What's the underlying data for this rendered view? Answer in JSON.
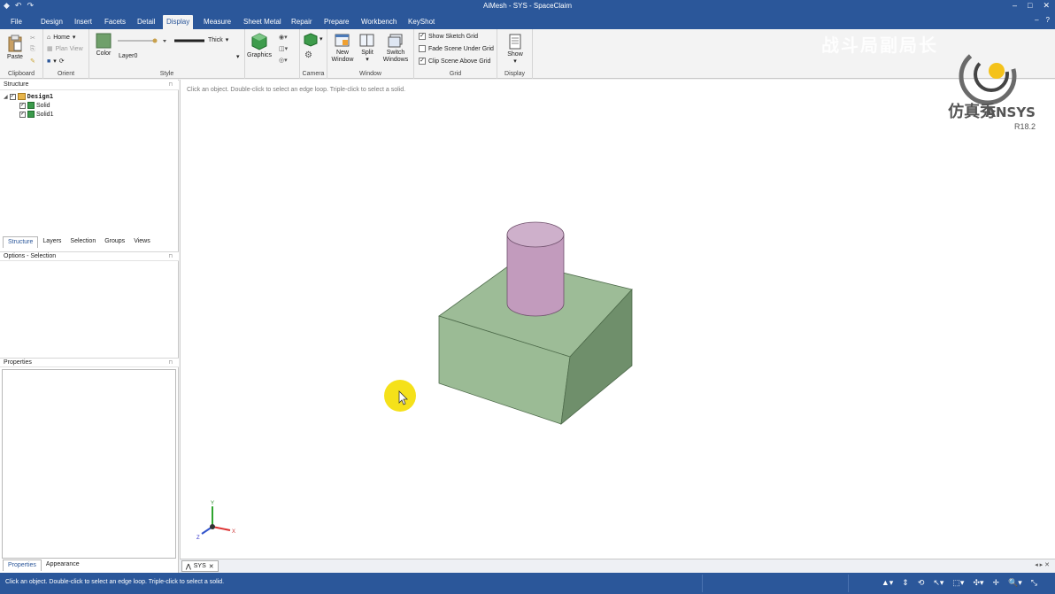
{
  "window": {
    "title": "AiMesh - SYS - SpaceClaim",
    "qat": [
      "↶",
      "↷"
    ],
    "controls": [
      "–",
      "□",
      "✕"
    ]
  },
  "ribbon_tabs": [
    {
      "label": "File",
      "active": false
    },
    {
      "label": "Design",
      "active": false
    },
    {
      "label": "Insert",
      "active": false
    },
    {
      "label": "Facets",
      "active": false
    },
    {
      "label": "Detail",
      "active": false
    },
    {
      "label": "Display",
      "active": true
    },
    {
      "label": "Measure",
      "active": false
    },
    {
      "label": "Sheet Metal",
      "active": false
    },
    {
      "label": "Repair",
      "active": false
    },
    {
      "label": "Prepare",
      "active": false
    },
    {
      "label": "Workbench",
      "active": false
    },
    {
      "label": "KeyShot",
      "active": false
    }
  ],
  "ribbon": {
    "clipboard": {
      "label": "Clipboard",
      "paste": "Paste"
    },
    "orient": {
      "label": "Orient",
      "home": "Home",
      "plan_view": "Plan View"
    },
    "style": {
      "label": "Style",
      "color": "Color",
      "layer": "Layer0",
      "line_weight": "Thick"
    },
    "graphics": {
      "label": "Graphics"
    },
    "camera": {
      "label": "Camera"
    },
    "window": {
      "label": "Window",
      "new_window": "New Window",
      "split": "Split",
      "switch_windows": "Switch Windows"
    },
    "grid": {
      "label": "Grid",
      "show_sketch_grid": {
        "label": "Show Sketch Grid",
        "checked": true
      },
      "fade_scene": {
        "label": "Fade Scene Under Grid",
        "checked": false
      },
      "clip_scene": {
        "label": "Clip Scene Above Grid",
        "checked": true
      }
    },
    "display": {
      "label": "Display",
      "show": "Show"
    }
  },
  "watermark": "战斗局副局长",
  "structure_panel": {
    "title": "Structure",
    "tree": [
      {
        "label": "Design1",
        "level": 0,
        "checked": true
      },
      {
        "label": "Solid",
        "level": 1,
        "checked": true
      },
      {
        "label": "Solid1",
        "level": 1,
        "checked": true
      }
    ],
    "tabs": [
      "Structure",
      "Layers",
      "Selection",
      "Groups",
      "Views"
    ]
  },
  "options_panel": {
    "title": "Options - Selection"
  },
  "properties_panel": {
    "title": "Properties",
    "tabs": [
      "Properties",
      "Appearance"
    ]
  },
  "viewport": {
    "hint": "Click an object. Double-click to select an edge loop. Triple-click to select a solid.",
    "logo_cn": "仿真秀",
    "logo_brand": "ANSYS",
    "logo_version": "R18.2",
    "axes": {
      "x": "X",
      "y": "Y",
      "z": "Z"
    },
    "colors": {
      "box": "#9dbc97",
      "cylinder": "#c8a4c4",
      "cursor_highlight": "#f5e11a"
    }
  },
  "doc_tab": {
    "label": "SYS"
  },
  "statusbar": {
    "text": "Click an object. Double-click to select an edge loop. Triple-click to select a solid."
  }
}
